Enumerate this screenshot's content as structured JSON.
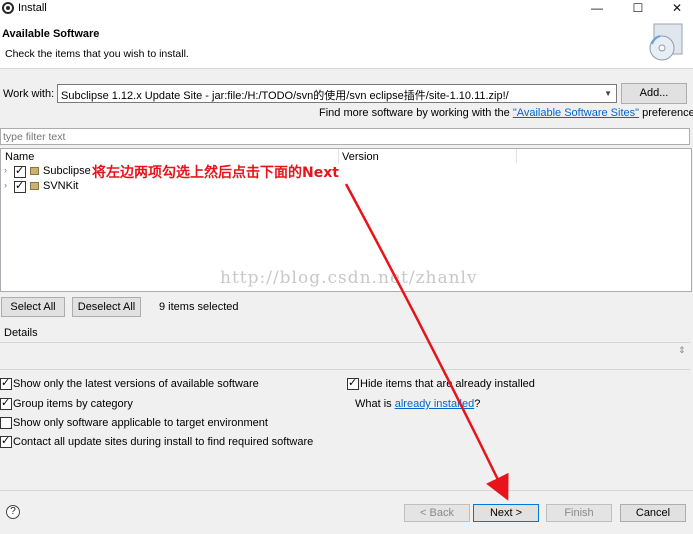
{
  "window": {
    "title": "Install",
    "minimize_glyph": "—",
    "maximize_glyph": "☐",
    "close_glyph": "✕"
  },
  "header": {
    "title": "Available Software",
    "subtitle": "Check the items that you wish to install."
  },
  "work_with": {
    "label": "Work with:",
    "value": "Subclipse 1.12.x Update Site - jar:file:/H:/TODO/svn的使用/svn eclipse插件/site-1.10.11.zip!/",
    "add_label": "Add..."
  },
  "find_more": {
    "prefix": "Find more software by working with the ",
    "link": "\"Available Software Sites\"",
    "suffix": " preferences."
  },
  "filter": {
    "placeholder": "type filter text"
  },
  "table": {
    "columns": [
      "Name",
      "Version"
    ],
    "rows": [
      {
        "label": "Subclipse",
        "checked": true
      },
      {
        "label": "SVNKit",
        "checked": true
      }
    ]
  },
  "annotation": {
    "text": "将左边两项勾选上然后点击下面的Next",
    "color": "#e8141b"
  },
  "watermark": "http://blog.csdn.net/zhanlv",
  "selection": {
    "select_all_label": "Select All",
    "deselect_all_label": "Deselect All",
    "count_text": "9 items selected"
  },
  "details": {
    "label": "Details"
  },
  "options": {
    "latest_only": {
      "label": "Show only the latest versions of available software",
      "checked": true
    },
    "group_by_category": {
      "label": "Group items by category",
      "checked": true
    },
    "target_env": {
      "label": "Show only software applicable to target environment",
      "checked": false
    },
    "contact_sites": {
      "label": "Contact all update sites during install to find required software",
      "checked": true
    },
    "hide_installed": {
      "label": "Hide items that are already installed",
      "checked": true
    },
    "what_is_prefix": "What is ",
    "what_is_link": "already installed",
    "what_is_suffix": "?"
  },
  "buttons": {
    "help_glyph": "?",
    "back_label": "< Back",
    "next_label": "Next >",
    "finish_label": "Finish",
    "cancel_label": "Cancel"
  },
  "colors": {
    "accent": "#0078d7",
    "link": "#0066cc",
    "annotation": "#e8141b"
  }
}
